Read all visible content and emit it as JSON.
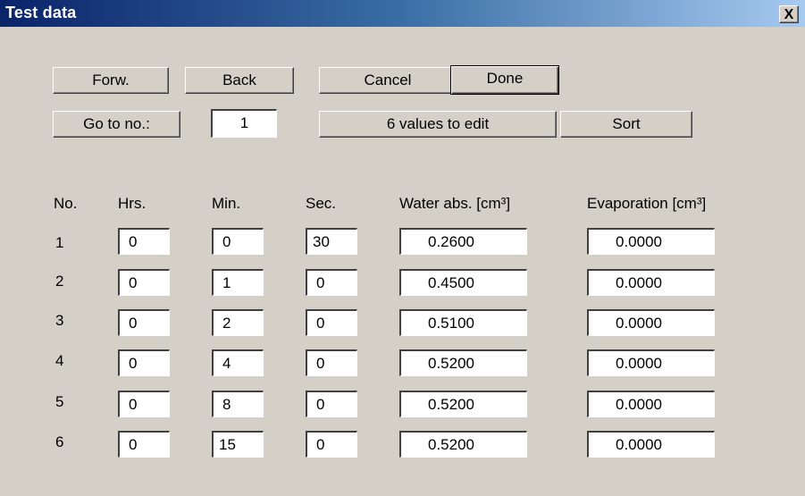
{
  "window": {
    "title": "Test data",
    "close_glyph": "X"
  },
  "toolbar": {
    "forward_label": "Forw.",
    "back_label": "Back",
    "cancel_label": "Cancel",
    "done_label": "Done",
    "goto_label": "Go to no.:",
    "goto_value": "1",
    "values_to_edit_label": "6 values to edit",
    "sort_label": "Sort"
  },
  "table": {
    "headers": [
      "No.",
      "Hrs.",
      "Min.",
      "Sec.",
      "Water abs. [cm³]",
      "Evaporation [cm³]"
    ],
    "rows": [
      {
        "no": "1",
        "hrs": "0",
        "min": "0",
        "sec": "30",
        "water": "0.2600",
        "evap": "0.0000"
      },
      {
        "no": "2",
        "hrs": "0",
        "min": "1",
        "sec": "0",
        "water": "0.4500",
        "evap": "0.0000"
      },
      {
        "no": "3",
        "hrs": "0",
        "min": "2",
        "sec": "0",
        "water": "0.5100",
        "evap": "0.0000"
      },
      {
        "no": "4",
        "hrs": "0",
        "min": "4",
        "sec": "0",
        "water": "0.5200",
        "evap": "0.0000"
      },
      {
        "no": "5",
        "hrs": "0",
        "min": "8",
        "sec": "0",
        "water": "0.5200",
        "evap": "0.0000"
      },
      {
        "no": "6",
        "hrs": "0",
        "min": "15",
        "sec": "0",
        "water": "0.5200",
        "evap": "0.0000"
      }
    ]
  },
  "colors": {
    "face": "#d4d0c8",
    "title_start": "#0a246a",
    "title_end": "#a6caf0"
  }
}
